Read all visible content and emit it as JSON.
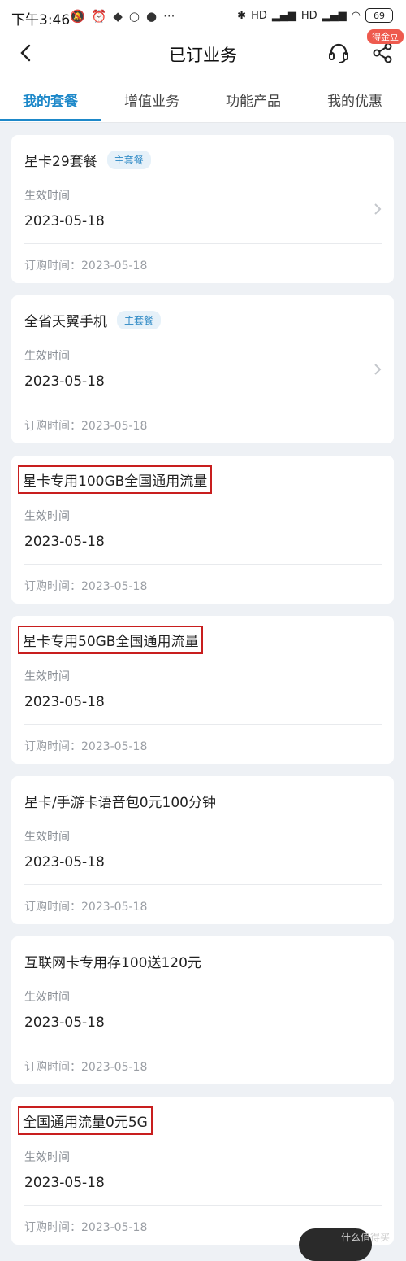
{
  "status_bar": {
    "time": "下午3:46",
    "battery": "69",
    "hd1": "HD",
    "hd2": "HD",
    "more": "···"
  },
  "header": {
    "title": "已订业务",
    "badge": "得金豆"
  },
  "tabs": [
    {
      "label": "我的套餐",
      "active": true
    },
    {
      "label": "增值业务",
      "active": false
    },
    {
      "label": "功能产品",
      "active": false
    },
    {
      "label": "我的优惠",
      "active": false
    }
  ],
  "cards": [
    {
      "title": "星卡29套餐",
      "tag": "主套餐",
      "effective_label": "生效时间",
      "effective_date": "2023-05-18",
      "order_line": "订购时间：2023-05-18"
    },
    {
      "title": "全省天翼手机",
      "tag": "主套餐",
      "effective_label": "生效时间",
      "effective_date": "2023-05-18",
      "order_line": "订购时间：2023-05-18"
    },
    {
      "title": "星卡专用100GB全国通用流量",
      "effective_label": "生效时间",
      "effective_date": "2023-05-18",
      "order_line": "订购时间：2023-05-18"
    },
    {
      "title": "星卡专用50GB全国通用流量",
      "effective_label": "生效时间",
      "effective_date": "2023-05-18",
      "order_line": "订购时间：2023-05-18"
    },
    {
      "title": "星卡/手游卡语音包0元100分钟",
      "effective_label": "生效时间",
      "effective_date": "2023-05-18",
      "order_line": "订购时间：2023-05-18"
    },
    {
      "title": "互联网卡专用存100送120元",
      "effective_label": "生效时间",
      "effective_date": "2023-05-18",
      "order_line": "订购时间：2023-05-18"
    },
    {
      "title": "全国通用流量0元5G",
      "effective_label": "生效时间",
      "effective_date": "2023-05-18",
      "order_line": "订购时间：2023-05-18"
    }
  ],
  "watermark": "什么值得买",
  "colors": {
    "accent": "#1d88c9",
    "highlight_box": "#c81e1e",
    "background": "#eef1f5"
  }
}
